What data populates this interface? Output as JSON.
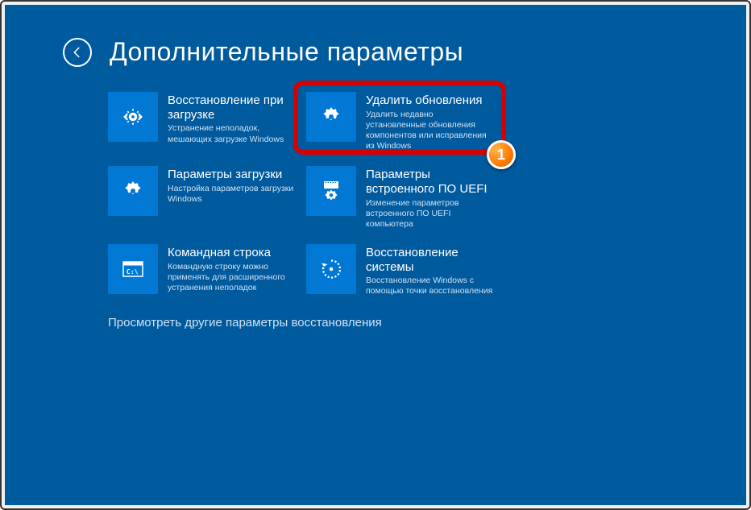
{
  "header": {
    "title": "Дополнительные параметры"
  },
  "tiles": [
    {
      "title": "Восстановление при загрузке",
      "desc": "Устранение неполадок, мешающих загрузке Windows"
    },
    {
      "title": "Удалить обновления",
      "desc": "Удалить недавно установленные обновления компонентов или исправления из Windows"
    },
    {
      "title": "Параметры загрузки",
      "desc": "Настройка параметров загрузки Windows"
    },
    {
      "title": "Параметры встроенного ПО UEFI",
      "desc": "Изменение параметров встроенного ПО UEFI компьютера"
    },
    {
      "title": "Командная строка",
      "desc": "Командную строку можно применять для расширенного устранения неполадок"
    },
    {
      "title": "Восстановление системы",
      "desc": "Восстановление Windows с помощью точки восстановления"
    }
  ],
  "more_link": "Просмотреть другие параметры восстановления",
  "marker": "1"
}
